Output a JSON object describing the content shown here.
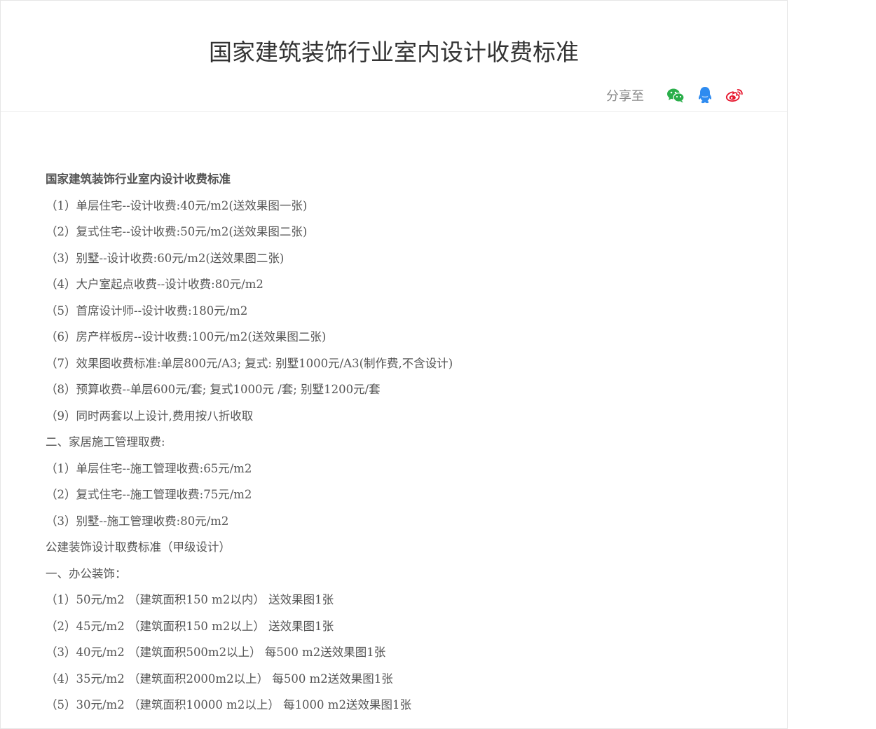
{
  "article": {
    "title": "国家建筑装饰行业室内设计收费标准",
    "share_label": "分享至",
    "share_icons": [
      "wechat-icon",
      "qq-icon",
      "weibo-icon"
    ],
    "colors": {
      "wechat": "#2aae4a",
      "qq": "#2e8bf0",
      "weibo": "#e6162d",
      "text": "#555555",
      "title": "#333333"
    },
    "lines": [
      "国家建筑装饰行业室内设计收费标准",
      "（1）单层住宅--设计收费:40元/m2(送效果图一张)",
      "（2）复式住宅--设计收费:50元/m2(送效果图二张)",
      "（3）别墅--设计收费:60元/m2(送效果图二张)",
      "（4）大户室起点收费--设计收费:80元/m2",
      "（5）首席设计师--设计收费:180元/m2",
      "（6）房产样板房--设计收费:100元/m2(送效果图二张)",
      "（7）效果图收费标准:单层800元/A3; 复式: 别墅1000元/A3(制作费,不含设计)",
      "（8）预算收费--单层600元/套; 复式1000元 /套; 别墅1200元/套",
      "（9）同时两套以上设计,费用按八折收取",
      "二、家居施工管理取费:",
      "（1）单层住宅--施工管理收费:65元/m2",
      "（2）复式住宅--施工管理收费:75元/m2",
      "（3）别墅--施工管理收费:80元/m2",
      "公建装饰设计取费标准（甲级设计）",
      "一、办公装饰：",
      "（1）50元/m2 （建筑面积150 m2以内） 送效果图1张",
      "（2）45元/m2 （建筑面积150 m2以上） 送效果图1张",
      "（3）40元/m2 （建筑面积500m2以上） 每500 m2送效果图1张",
      "（4）35元/m2 （建筑面积2000m2以上） 每500 m2送效果图1张",
      "（5）30元/m2 （建筑面积10000 m2以上） 每1000 m2送效果图1张"
    ]
  }
}
